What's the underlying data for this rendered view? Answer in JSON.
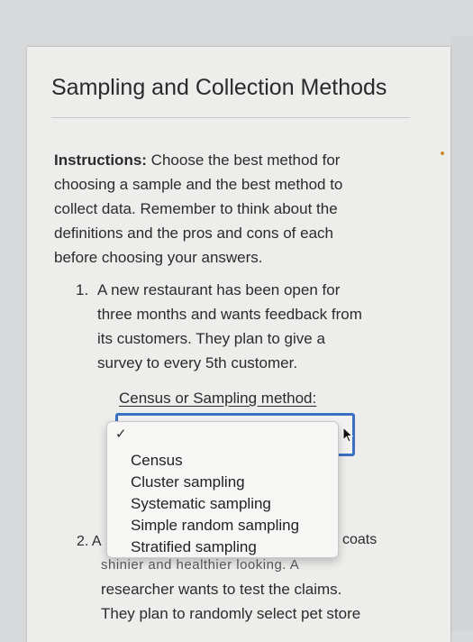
{
  "title": "Sampling and Collection Methods",
  "instructions": {
    "bold": "Instructions:",
    "lines": [
      " Choose the best method for",
      "choosing a sample and the best method to",
      "collect data. Remember to think about the",
      "definitions and the pros and cons of each",
      "before choosing your answers."
    ]
  },
  "question1": {
    "number": "1.",
    "lines": [
      "A new restaurant has been open for",
      "three months and wants feedback from",
      "its customers. They plan to give a",
      "survey to every 5th customer."
    ],
    "select_label": "Census or Sampling method:",
    "selected_value": ""
  },
  "dropdown": {
    "check": "✓",
    "options": [
      "Census",
      "Cluster sampling",
      "Systematic sampling",
      "Simple random sampling",
      "Stratified sampling"
    ]
  },
  "question2": {
    "number": "2. A",
    "partial_right": "coats",
    "clipped_line": "shinier and healthier looking. A",
    "lines": [
      "researcher wants to test the claims.",
      "They plan to randomly select pet store"
    ]
  }
}
